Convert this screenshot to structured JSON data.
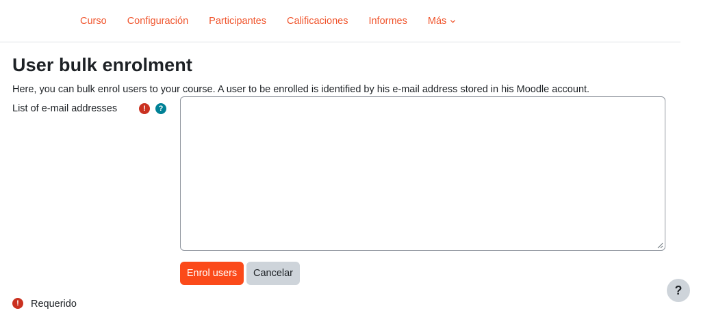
{
  "nav": {
    "tabs": [
      {
        "label": "Curso"
      },
      {
        "label": "Configuración"
      },
      {
        "label": "Participantes"
      },
      {
        "label": "Calificaciones"
      },
      {
        "label": "Informes"
      },
      {
        "label": "Más"
      }
    ]
  },
  "page": {
    "title": "User bulk enrolment",
    "description": "Here, you can bulk enrol users to your course. A user to be enrolled is identified by his e-mail address stored in his Moodle account."
  },
  "form": {
    "field_label": "List of e-mail addresses",
    "required_icon": "exclamation-circle-icon",
    "help_icon": "question-circle-icon",
    "textarea_value": "",
    "submit_label": "Enrol users",
    "cancel_label": "Cancelar"
  },
  "legend": {
    "required_label": "Requerido"
  },
  "help_fab": {
    "label": "?"
  },
  "colors": {
    "accent": "#f0542c",
    "primary_button": "#fb4a1a",
    "secondary_button": "#ced4da",
    "required": "#ca3120",
    "help": "#008196"
  }
}
